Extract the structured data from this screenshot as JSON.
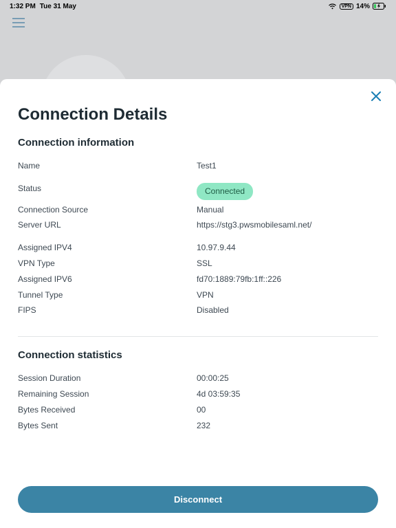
{
  "statusbar": {
    "time": "1:32 PM",
    "date": "Tue 31 May",
    "battery": "14%"
  },
  "sheet": {
    "title": "Connection Details",
    "section_info": "Connection information",
    "section_stats": "Connection statistics",
    "disconnect": "Disconnect",
    "info": {
      "name_label": "Name",
      "name_value": "Test1",
      "status_label": "Status",
      "status_value": "Connected",
      "source_label": "Connection Source",
      "source_value": "Manual",
      "server_label": "Server URL",
      "server_value": "https://stg3.pwsmobilesaml.net/",
      "ipv4_label": "Assigned IPV4",
      "ipv4_value": "10.97.9.44",
      "vpntype_label": "VPN Type",
      "vpntype_value": "SSL",
      "ipv6_label": "Assigned IPV6",
      "ipv6_value": "fd70:1889:79fb:1ff::226",
      "tunnel_label": "Tunnel Type",
      "tunnel_value": "VPN",
      "fips_label": "FIPS",
      "fips_value": "Disabled"
    },
    "stats": {
      "duration_label": "Session Duration",
      "duration_value": "00:00:25",
      "remaining_label": "Remaining Session",
      "remaining_value": "4d 03:59:35",
      "rx_label": "Bytes Received",
      "rx_value": "00",
      "tx_label": "Bytes Sent",
      "tx_value": "232"
    }
  }
}
